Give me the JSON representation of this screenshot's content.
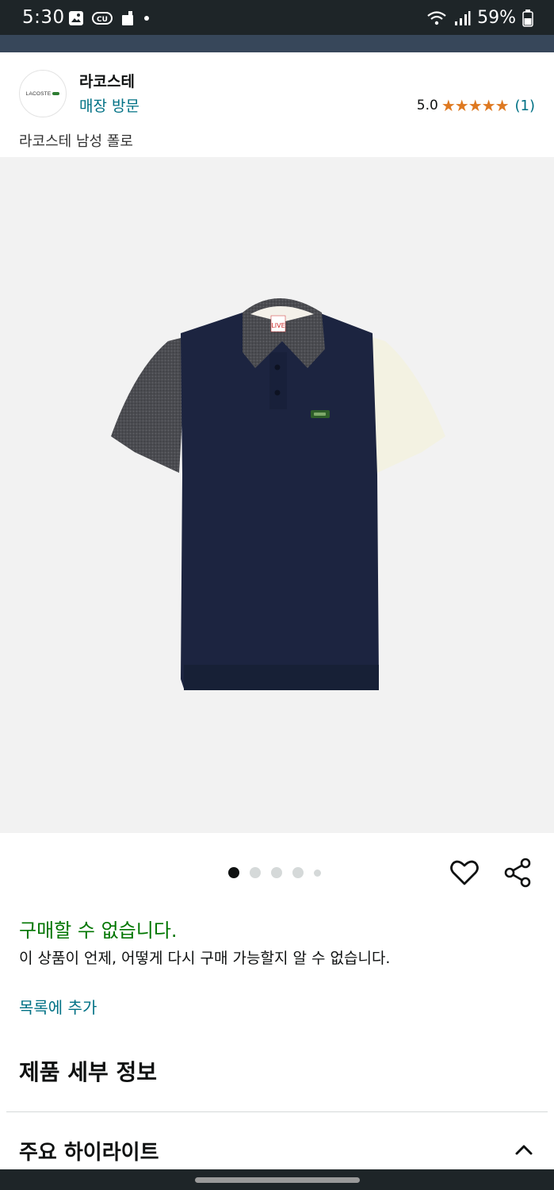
{
  "status": {
    "time": "5:30",
    "battery": "59%"
  },
  "seller": {
    "logo_text": "LACOSTE",
    "store_name": "라코스테",
    "visit_label": "매장 방문",
    "rating_value": "5.0",
    "rating_stars": 5,
    "rating_count": "(1)"
  },
  "product": {
    "subtitle": "라코스테 남성 폴로",
    "tag_text": "LIVE",
    "image_count": 5,
    "active_image": 1,
    "colors": {
      "body": "#1c2440",
      "left_sleeve": "#4b4c51",
      "right_sleeve": "#f3f2e2",
      "collar": "#4a4b50"
    }
  },
  "availability": {
    "status": "구매할 수 없습니다.",
    "description": "이 상품이 언제, 어떻게 다시 구매 가능할지 알 수 없습니다."
  },
  "actions": {
    "add_to_list": "목록에 추가",
    "wishlist_icon": "heart-icon",
    "share_icon": "share-icon"
  },
  "details": {
    "section_title": "제품 세부 정보",
    "highlights_title": "주요 하이라이트"
  },
  "theme": {
    "link": "#007185",
    "success": "#007600",
    "star": "#de7921"
  }
}
